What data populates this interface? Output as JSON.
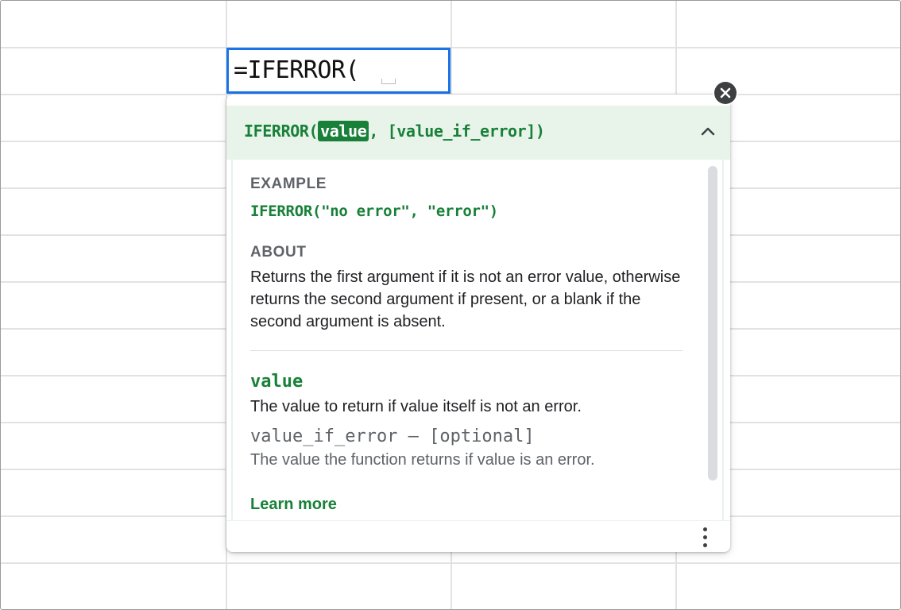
{
  "cell": {
    "formula_text": "=IFERROR("
  },
  "tooltip": {
    "signature": {
      "fn_open": "IFERROR(",
      "active_arg": "value",
      "rest": ", [value_if_error])"
    },
    "example_label": "EXAMPLE",
    "example_code": "IFERROR(\"no error\", \"error\")",
    "about_label": "ABOUT",
    "about_text": "Returns the first argument if it is not an error value, otherwise returns the second argument if present, or a blank if the second argument is absent.",
    "args": [
      {
        "name": "value",
        "description": "The value to return if value itself is not an error."
      },
      {
        "name": "value_if_error – [optional]",
        "description": "The value the function returns if value is an error."
      }
    ],
    "learn_more": "Learn more"
  },
  "colors": {
    "accent_green": "#188038",
    "header_bg": "#e8f3ea",
    "selection_blue": "#1a73e8"
  },
  "icons": {
    "close": "close-icon",
    "collapse": "chevron-up-icon",
    "more": "more-vert-icon"
  }
}
